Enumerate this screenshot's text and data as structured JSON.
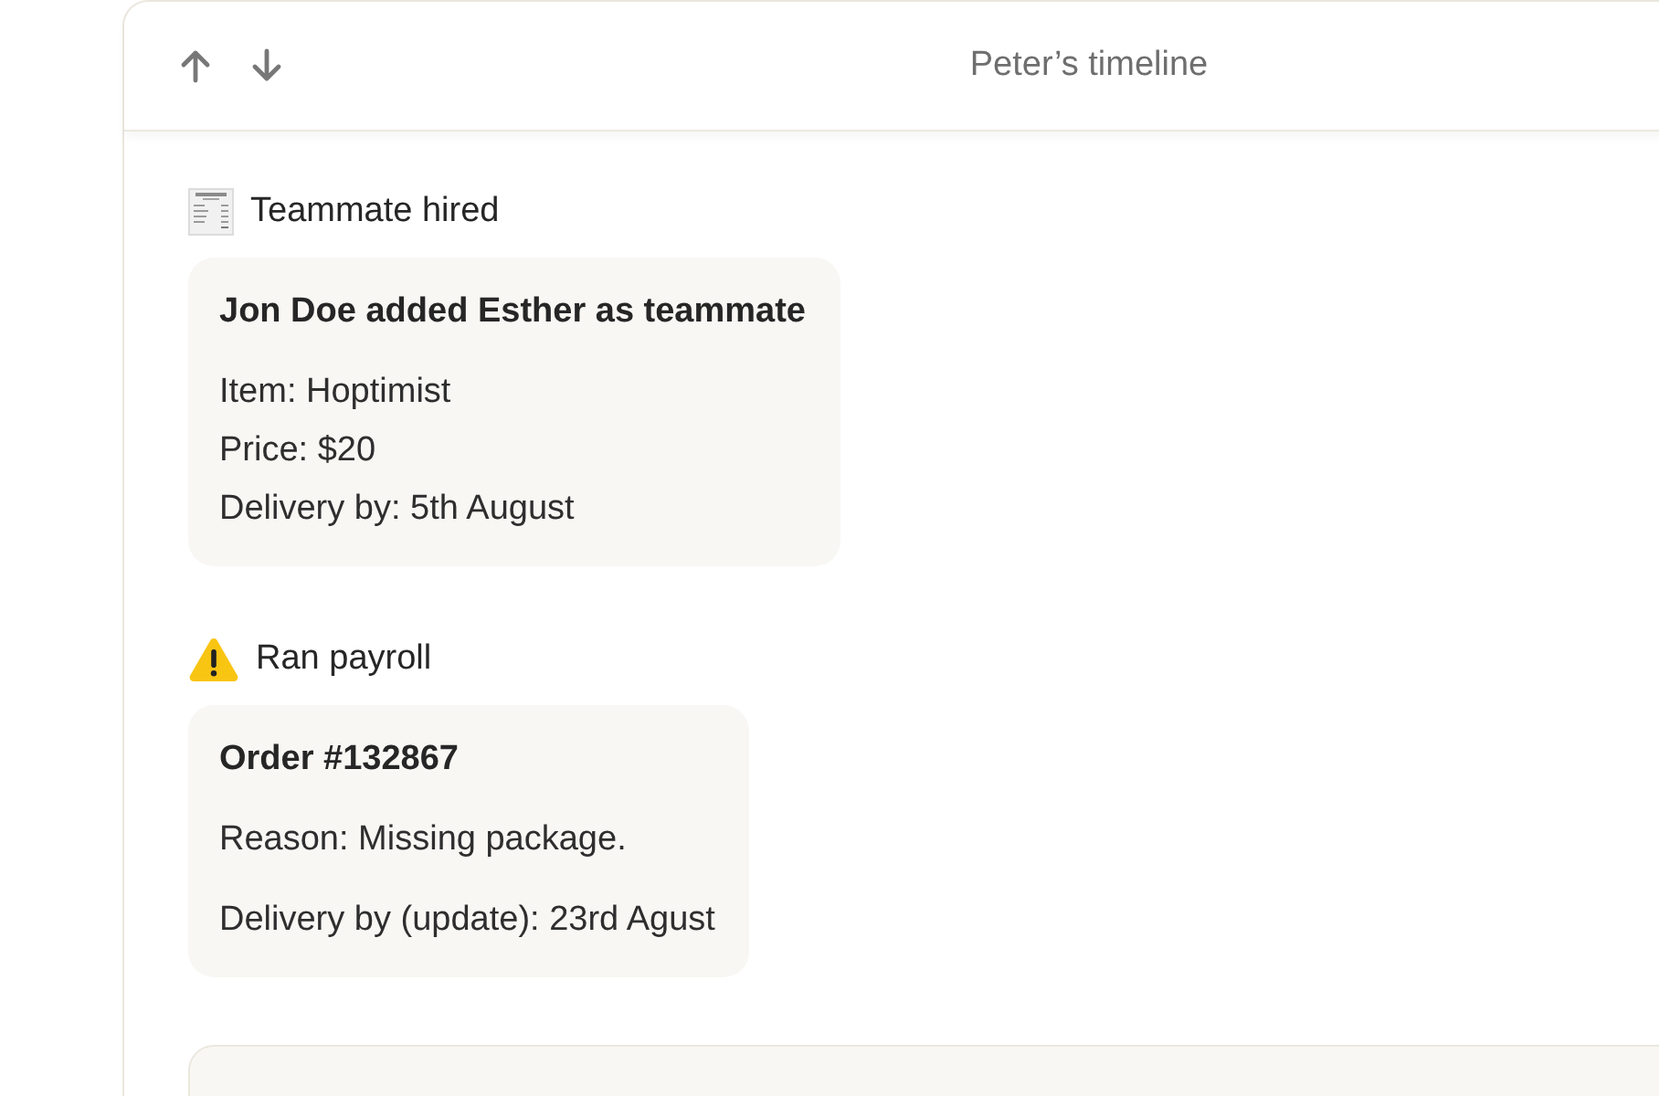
{
  "header": {
    "title": "Peter’s timeline"
  },
  "events": [
    {
      "kind": "info",
      "title": "Teammate hired",
      "card": {
        "heading": "Jon Doe added Esther as teammate",
        "spaced": false,
        "lines": [
          "Item: Hoptimist",
          "Price: $20",
          "Delivery by: 5th August"
        ]
      }
    },
    {
      "kind": "warning",
      "title": "Ran payroll",
      "card": {
        "heading": "Order #132867",
        "spaced": true,
        "lines": [
          "Reason: Missing package.",
          "Delivery by (update): 23rd Agust"
        ]
      }
    }
  ],
  "more_below": true
}
